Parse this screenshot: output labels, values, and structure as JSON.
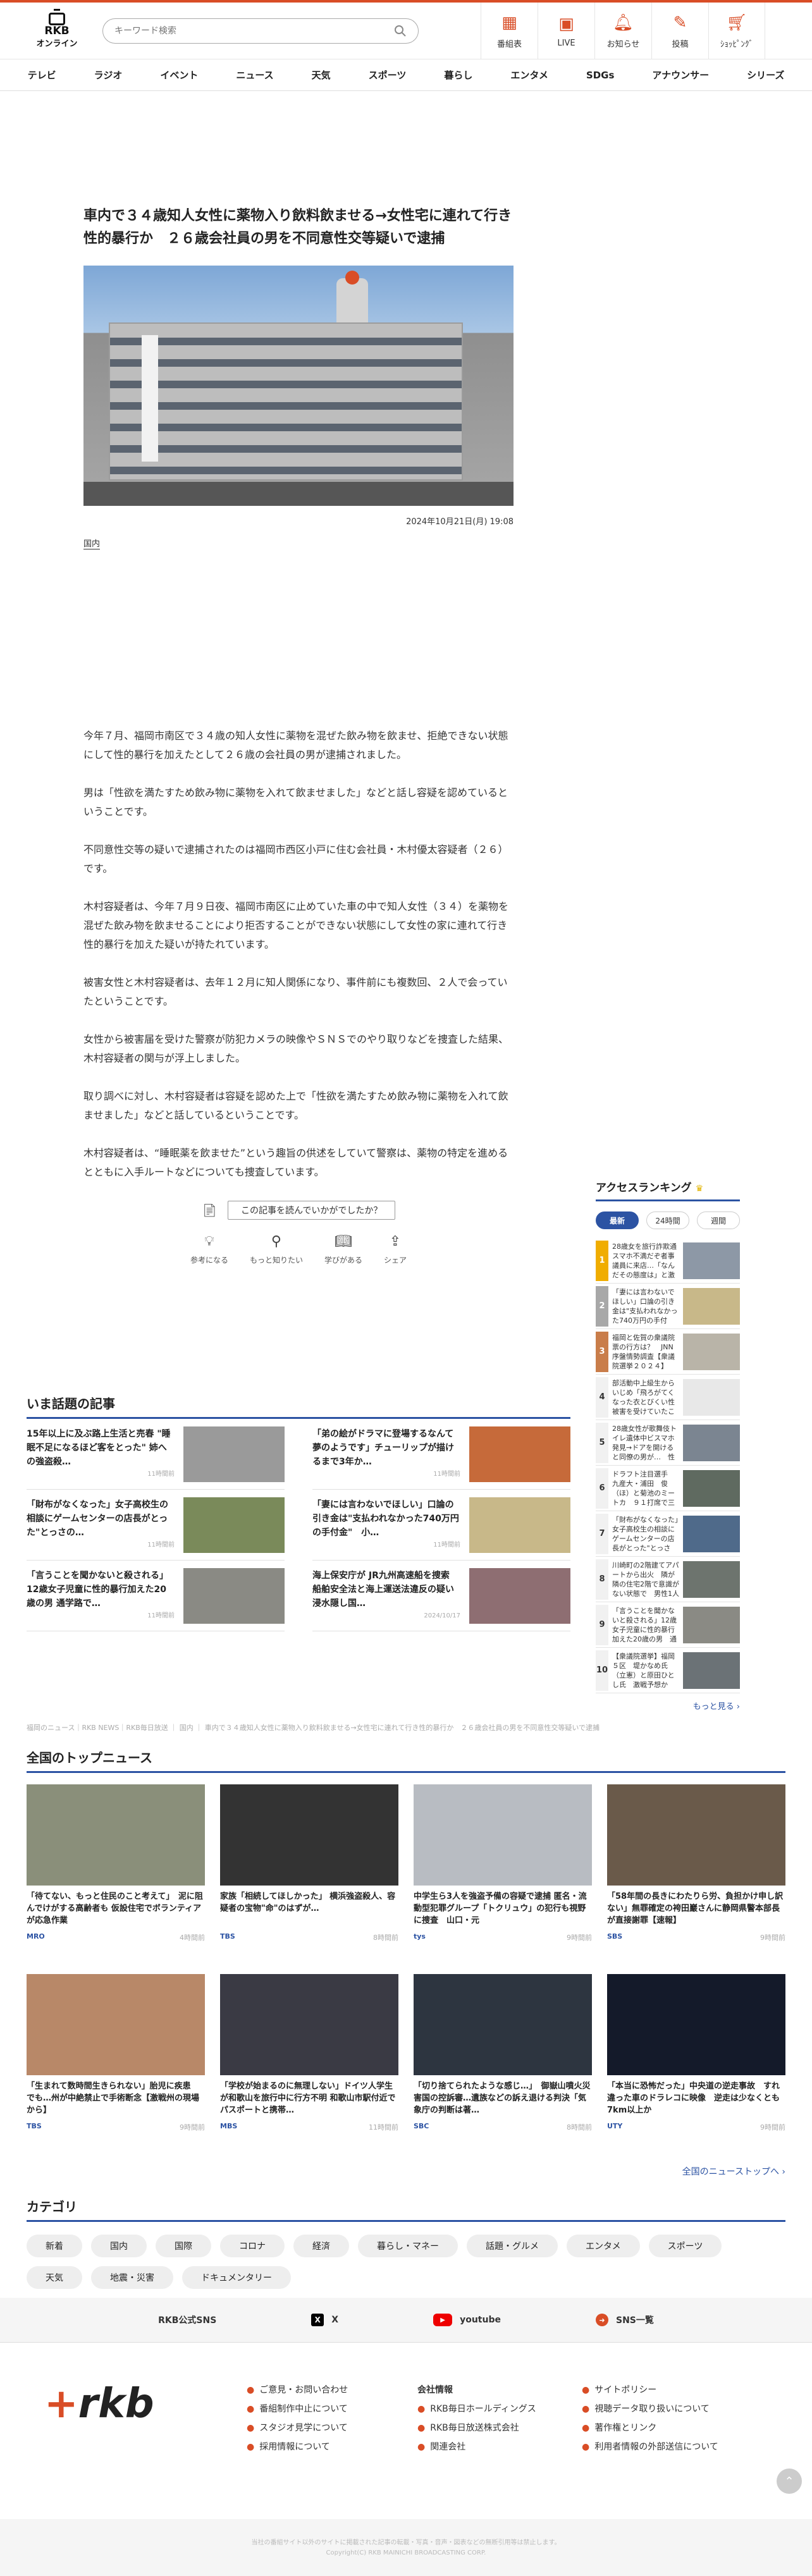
{
  "header": {
    "logo_title": "RKB",
    "logo_sub": "オンライン",
    "search_placeholder": "キーワード検索",
    "icons": [
      {
        "label": "番組表",
        "icon": "calendar-icon"
      },
      {
        "label": "LIVE",
        "icon": "live-icon"
      },
      {
        "label": "お知らせ",
        "icon": "bell-icon"
      },
      {
        "label": "投稿",
        "icon": "post-icon"
      },
      {
        "label": "ｼｮｯﾋﾟﾝｸﾞ",
        "icon": "cart-icon"
      }
    ]
  },
  "nav": [
    "テレビ",
    "ラジオ",
    "イベント",
    "ニュース",
    "天気",
    "スポーツ",
    "暮らし",
    "エンタメ",
    "SDGs",
    "アナウンサー",
    "シリーズ"
  ],
  "article": {
    "title": "車内で３４歳知人女性に薬物入り飲料飲ませる→女性宅に連れて行き性的暴行か　２６歳会社員の男を不同意性交等疑いで逮捕",
    "date": "2024年10月21日(月) 19:08",
    "tag": "国内",
    "paragraphs": [
      "今年７月、福岡市南区で３４歳の知人女性に薬物を混ぜた飲み物を飲ませ、拒絶できない状態にして性的暴行を加えたとして２６歳の会社員の男が逮捕されました。",
      "男は「性欲を満たすため飲み物に薬物を入れて飲ませました」などと話し容疑を認めているということです。",
      "不同意性交等の疑いで逮捕されたのは福岡市西区小戸に住む会社員・木村優太容疑者（２６）です。",
      "木村容疑者は、今年７月９日夜、福岡市南区に止めていた車の中で知人女性（３４）を薬物を混ぜた飲み物を飲ませることにより拒否することができない状態にして女性の家に連れて行き性的暴行を加えた疑いが持たれています。",
      "被害女性と木村容疑者は、去年１２月に知人関係になり、事件前にも複数回、２人で会っていたということです。",
      "女性から被害届を受けた警察が防犯カメラの映像やＳＮＳでのやり取りなどを捜査した結果、木村容疑者の関与が浮上しました。",
      "取り調べに対し、木村容疑者は容疑を認めた上で「性欲を満たすため飲み物に薬物を入れて飲ませました」などと話しているということです。",
      "木村容疑者は、“睡眠薬を飲ませた”という趣旨の供述をしていて警察は、薬物の特定を進めるとともに入手ルートなどについても捜査しています。"
    ],
    "feedback_question": "この記事を読んでいかがでしたか？",
    "feedback": [
      {
        "label": "参考になる",
        "icon": "bulb-icon"
      },
      {
        "label": "もっと知りたい",
        "icon": "search-icon"
      },
      {
        "label": "学びがある",
        "icon": "book-icon"
      },
      {
        "label": "シェア",
        "icon": "share-icon"
      }
    ]
  },
  "ranking": {
    "title": "アクセスランキング",
    "tabs": [
      "最新",
      "24時間",
      "週間"
    ],
    "items": [
      {
        "num": "1",
        "text": "28歳女を旅行詐欺通　スマホ不満だぞ者事議員に来店…「なんだその態度は」と激怒、客…"
      },
      {
        "num": "2",
        "text": "「妻には言わないでほしい」口論の引き金は\"支払われなかった740万円の手付金\"…"
      },
      {
        "num": "3",
        "text": "福岡と佐賀の衆議院　票の行方は？　JNN序盤情勢調査【衆議院選挙２０２４】"
      },
      {
        "num": "4",
        "text": "部活動中上級生からいじめ「飛ろがてくなった衣とびくい性被害を受けていたことを…"
      },
      {
        "num": "5",
        "text": "28歳女性が歌舞伎トイレ遺体中ビスマホ発見→ドアを開けると同僚の男が…　性的暴…"
      },
      {
        "num": "6",
        "text": "ドラフト注目選手　九産大・浦田　俊（ほ）と菊池のミートカ　９１打席で三振ゼロの打…"
      },
      {
        "num": "7",
        "text": "「財布がなくなった」女子高校生の相談にゲームセンターの店長がとった\"とっさの…"
      },
      {
        "num": "8",
        "text": "川崎町の2階建てアパートから出火　隣が隣の住宅2階で意識がない状態で　男性1人を…"
      },
      {
        "num": "9",
        "text": "「言うことを聞かないと殺される」12歳女子児童に性的暴行加えた20歳の男　通学路で…"
      },
      {
        "num": "10",
        "text": "【衆議院選挙】福岡５区　堤かなめ氏（立憲）と原田ひとし氏　激戦予想か"
      }
    ],
    "more": "もっと見る ›"
  },
  "trending": {
    "title": "いま話題の記事",
    "items": [
      {
        "text": "15年以上に及ぶ路上生活と売春 \"睡眠不足になるほど客をとった\" 姉への強盗殺…",
        "time": "11時間前"
      },
      {
        "text": "「弟の絵がドラマに登場するなんて夢のようです」チューリップが描けるまで3年か…",
        "time": "11時間前"
      },
      {
        "text": "「財布がなくなった」女子高校生の相談にゲームセンターの店長がとった\"とっさの…",
        "time": "11時間前"
      },
      {
        "text": "「妻には言わないでほしい」口論の引き金は\"支払われなかった740万円の手付金\"　小…",
        "time": "11時間前"
      },
      {
        "text": "「言うことを聞かないと殺される」12歳女子児童に性的暴行加えた20歳の男 通学路で…",
        "time": "11時間前"
      },
      {
        "text": "海上保安庁が JR九州高速船を捜索　船舶安全法と海上運送法違反の疑い　浸水隠し国…",
        "time": "2024/10/17"
      }
    ]
  },
  "breadcrumb": "福岡のニュース｜RKB NEWS｜RKB毎日放送 ｜ 国内 ｜ 車内で３４歳知人女性に薬物入り飲料飲ませる→女性宅に連れて行き性的暴行か　２６歳会社員の男を不同意性交等疑いで逮捕",
  "top_news": {
    "title": "全国のトップニュース",
    "items": [
      {
        "text": "「待てない、もっと住民のこと考えて」　泥に阻んでけがする高齢者も 仮設住宅でボランティアが応急作業",
        "source": "MRO",
        "time": "4時間前"
      },
      {
        "text": "家族「相続してほしかった」 横浜強盗殺人、容疑者の宝物\"命\"のはずが…",
        "source": "TBS",
        "time": "8時間前"
      },
      {
        "text": "中学生ら3人を強盗予備の容疑で逮捕 匿名・流動型犯罪グループ「トクリュウ」の犯行も視野に捜査　山口・元",
        "source": "tys",
        "time": "9時間前"
      },
      {
        "text": "「58年間の長きにわたりら労、負担かけ申し訳ない」無罪確定の袴田巖さんに静岡県警本部長が直接謝罪【速報】",
        "source": "SBS",
        "time": "9時間前"
      },
      {
        "text": "「生まれて数時間生きられない」胎児に疾患　でも…州が中絶禁止で手術断念【激戦州の現場から】",
        "source": "TBS",
        "time": "9時間前"
      },
      {
        "text": "「学校が始まるのに無理しない」ドイツ人学生が和歌山を旅行中に行方不明 和歌山市駅付近でパスポートと携帯…",
        "source": "MBS",
        "time": "11時間前"
      },
      {
        "text": "「切り捨てられたような感じ…」　御嶽山噴火災害国の控訴審…遺族などの訴え退ける判決「気象庁の判断は著…",
        "source": "SBC",
        "time": "8時間前"
      },
      {
        "text": "「本当に恐怖だった」中央道の逆走事故　すれ違った車のドラレコに映像　逆走は少なくとも7km以上か",
        "source": "UTY",
        "time": "9時間前"
      }
    ],
    "more": "全国のニューストップへ ›"
  },
  "categories": {
    "title": "カテゴリ",
    "items": [
      "新着",
      "国内",
      "国際",
      "コロナ",
      "経済",
      "暮らし・マネー",
      "話題・グルメ",
      "エンタメ",
      "スポーツ",
      "天気",
      "地震・災害",
      "ドキュメンタリー"
    ]
  },
  "sns": {
    "title": "RKB公式SNS",
    "items": [
      {
        "label": "X",
        "icon": "x-icon"
      },
      {
        "label": "youtube",
        "icon": "youtube-icon"
      },
      {
        "label": "SNS一覧",
        "icon": "sns-icon"
      }
    ]
  },
  "footer": {
    "logo": "rkb",
    "col1": [
      "ご意見・お問い合わせ",
      "番組制作中止について",
      "スタジオ見学について",
      "採用情報について"
    ],
    "col2_head": "会社情報",
    "col2": [
      "RKB毎日ホールディングス",
      "RKB毎日放送株式会社",
      "関連会社"
    ],
    "col3": [
      "サイトポリシー",
      "視聴データ取り扱いについて",
      "著作権とリンク",
      "利用者情報の外部送信について"
    ],
    "copyright_1": "当社の番組サイト以外のサイトに掲載された記事の転載・写真・音声・図表などの無断引用等は禁止します。",
    "copyright_2": "Copyright(C) RKB MAINICHI BROADCASTING CORP."
  },
  "colors": {
    "accent": "#d94d26",
    "link": "#2c53a3"
  }
}
